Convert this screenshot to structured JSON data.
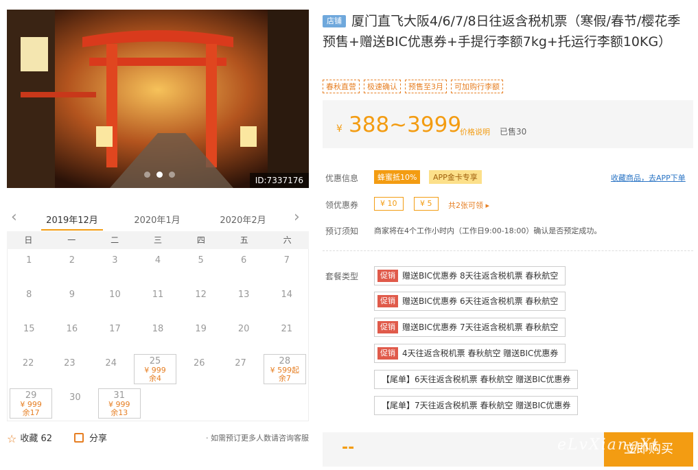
{
  "gallery": {
    "id_label": "ID:7337176",
    "dots": 3,
    "active_dot": 2
  },
  "calendar": {
    "months": [
      "2019年12月",
      "2020年1月",
      "2020年2月"
    ],
    "active_month": 0,
    "weekdays": [
      "日",
      "一",
      "二",
      "三",
      "四",
      "五",
      "六"
    ],
    "weeks": [
      [
        {
          "d": "1"
        },
        {
          "d": "2"
        },
        {
          "d": "3"
        },
        {
          "d": "4"
        },
        {
          "d": "5"
        },
        {
          "d": "6"
        },
        {
          "d": "7"
        }
      ],
      [
        {
          "d": "8"
        },
        {
          "d": "9"
        },
        {
          "d": "10"
        },
        {
          "d": "11"
        },
        {
          "d": "12"
        },
        {
          "d": "13"
        },
        {
          "d": "14"
        }
      ],
      [
        {
          "d": "15"
        },
        {
          "d": "16"
        },
        {
          "d": "17"
        },
        {
          "d": "18"
        },
        {
          "d": "19"
        },
        {
          "d": "20"
        },
        {
          "d": "21"
        }
      ],
      [
        {
          "d": "22"
        },
        {
          "d": "23"
        },
        {
          "d": "24"
        },
        {
          "d": "25",
          "price": "¥ 999",
          "rem": "余4"
        },
        {
          "d": "26"
        },
        {
          "d": "27"
        },
        {
          "d": "28",
          "price": "¥ 599起",
          "rem": "余7"
        }
      ],
      [
        {
          "d": "29",
          "price": "¥ 999",
          "rem": "余17"
        },
        {
          "d": "30"
        },
        {
          "d": "31",
          "price": "¥ 999",
          "rem": "余13"
        },
        {
          "d": ""
        },
        {
          "d": ""
        },
        {
          "d": ""
        },
        {
          "d": ""
        }
      ]
    ]
  },
  "actions": {
    "favorite": "收藏",
    "favorite_count": "62",
    "share": "分享",
    "group_note": "· 如需预订更多人数请咨询客服"
  },
  "product": {
    "shop_tag": "店铺",
    "title": "厦门直飞大阪4/6/7/8日往返含税机票（寒假/春节/樱花季预售+赠送BIC优惠券+手提行李额7kg+托运行李额10KG）",
    "tags": [
      "春秋直营",
      "极速确认",
      "预售至3月",
      "可加购行李额"
    ]
  },
  "price": {
    "currency": "¥",
    "range": "388~3999",
    "explain": "价格说明",
    "sold": "已售30"
  },
  "discount": {
    "label": "优惠信息",
    "badge1": "蜂蜜抵10%",
    "badge2": "APP金卡专享",
    "collect_link": "收藏商品，去APP下单"
  },
  "coupons": {
    "label": "领优惠券",
    "items": [
      "¥ 10",
      "¥ 5"
    ],
    "count": "共2张可领 ▸"
  },
  "booking": {
    "label": "预订须知",
    "text": "商家将在4个工作小时内（工作日9:00-18:00）确认是否预定成功。"
  },
  "packages": {
    "label": "套餐类型",
    "promo_label": "促销",
    "items": [
      {
        "promo": true,
        "text": "赠送BIC优惠券 8天往返含税机票 春秋航空"
      },
      {
        "promo": true,
        "text": "赠送BIC优惠券 6天往返含税机票 春秋航空"
      },
      {
        "promo": true,
        "text": "赠送BIC优惠券 7天往返含税机票 春秋航空"
      },
      {
        "promo": true,
        "text": "4天往返含税机票 春秋航空 赠送BIC优惠券"
      },
      {
        "promo": false,
        "text": "【尾单】6天往返含税机票 春秋航空 赠送BIC优惠券"
      },
      {
        "promo": false,
        "text": "【尾单】7天往返含税机票 春秋航空 赠送BIC优惠券"
      }
    ]
  },
  "buy": {
    "total": "--",
    "button": "立即购买",
    "watermark": "eLvXiangXt"
  },
  "colors": {
    "accent": "#f39c12",
    "promo": "#e05a4a",
    "link": "#2a74c4"
  }
}
